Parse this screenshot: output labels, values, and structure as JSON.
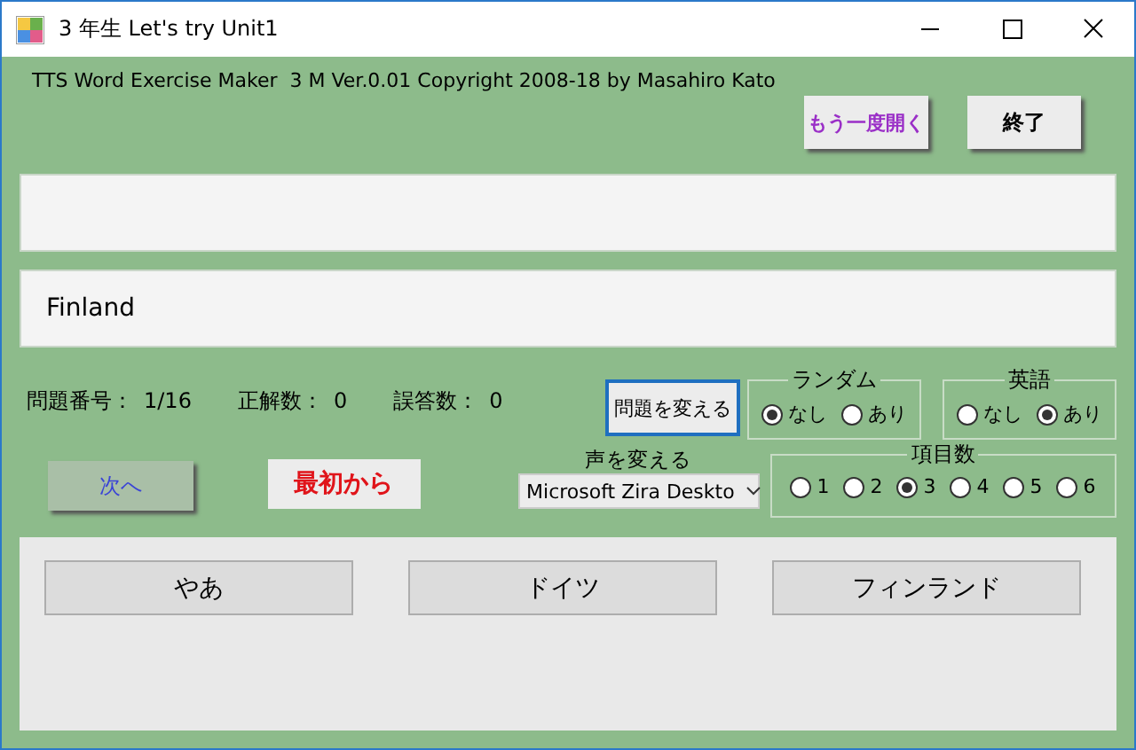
{
  "window": {
    "title": "3 年生 Let's try Unit1"
  },
  "copyright": "TTS Word Exercise Maker  3 M Ver.0.01 Copyright 2008-18 by Masahiro Kato",
  "top_buttons": [
    {
      "label": "もう一度開く",
      "kind": "reopen"
    },
    {
      "label": "終了",
      "kind": "quit"
    }
  ],
  "answer_box": {
    "value": "Finland"
  },
  "stats": [
    {
      "label": "問題番号：",
      "value": "1/16"
    },
    {
      "label": "正解数：",
      "value": "0"
    },
    {
      "label": "誤答数：",
      "value": "0"
    }
  ],
  "change_question_button": "問題を変える",
  "groups": [
    {
      "title": "ランダム",
      "options": [
        {
          "label": "なし",
          "selected": true
        },
        {
          "label": "あり",
          "selected": false
        }
      ]
    },
    {
      "title": "英語",
      "options": [
        {
          "label": "なし",
          "selected": false
        },
        {
          "label": "あり",
          "selected": true
        }
      ]
    },
    {
      "title": "項目数",
      "options": [
        {
          "label": "1",
          "selected": false
        },
        {
          "label": "2",
          "selected": false
        },
        {
          "label": "3",
          "selected": true
        },
        {
          "label": "4",
          "selected": false
        },
        {
          "label": "5",
          "selected": false
        },
        {
          "label": "6",
          "selected": false
        }
      ]
    }
  ],
  "next_button": "次へ",
  "restart_button": "最初から",
  "voice": {
    "label": "声を変える",
    "value": "Microsoft Zira Deskto"
  },
  "choices": [
    {
      "label": "やあ"
    },
    {
      "label": "ドイツ"
    },
    {
      "label": "フィンランド"
    }
  ]
}
